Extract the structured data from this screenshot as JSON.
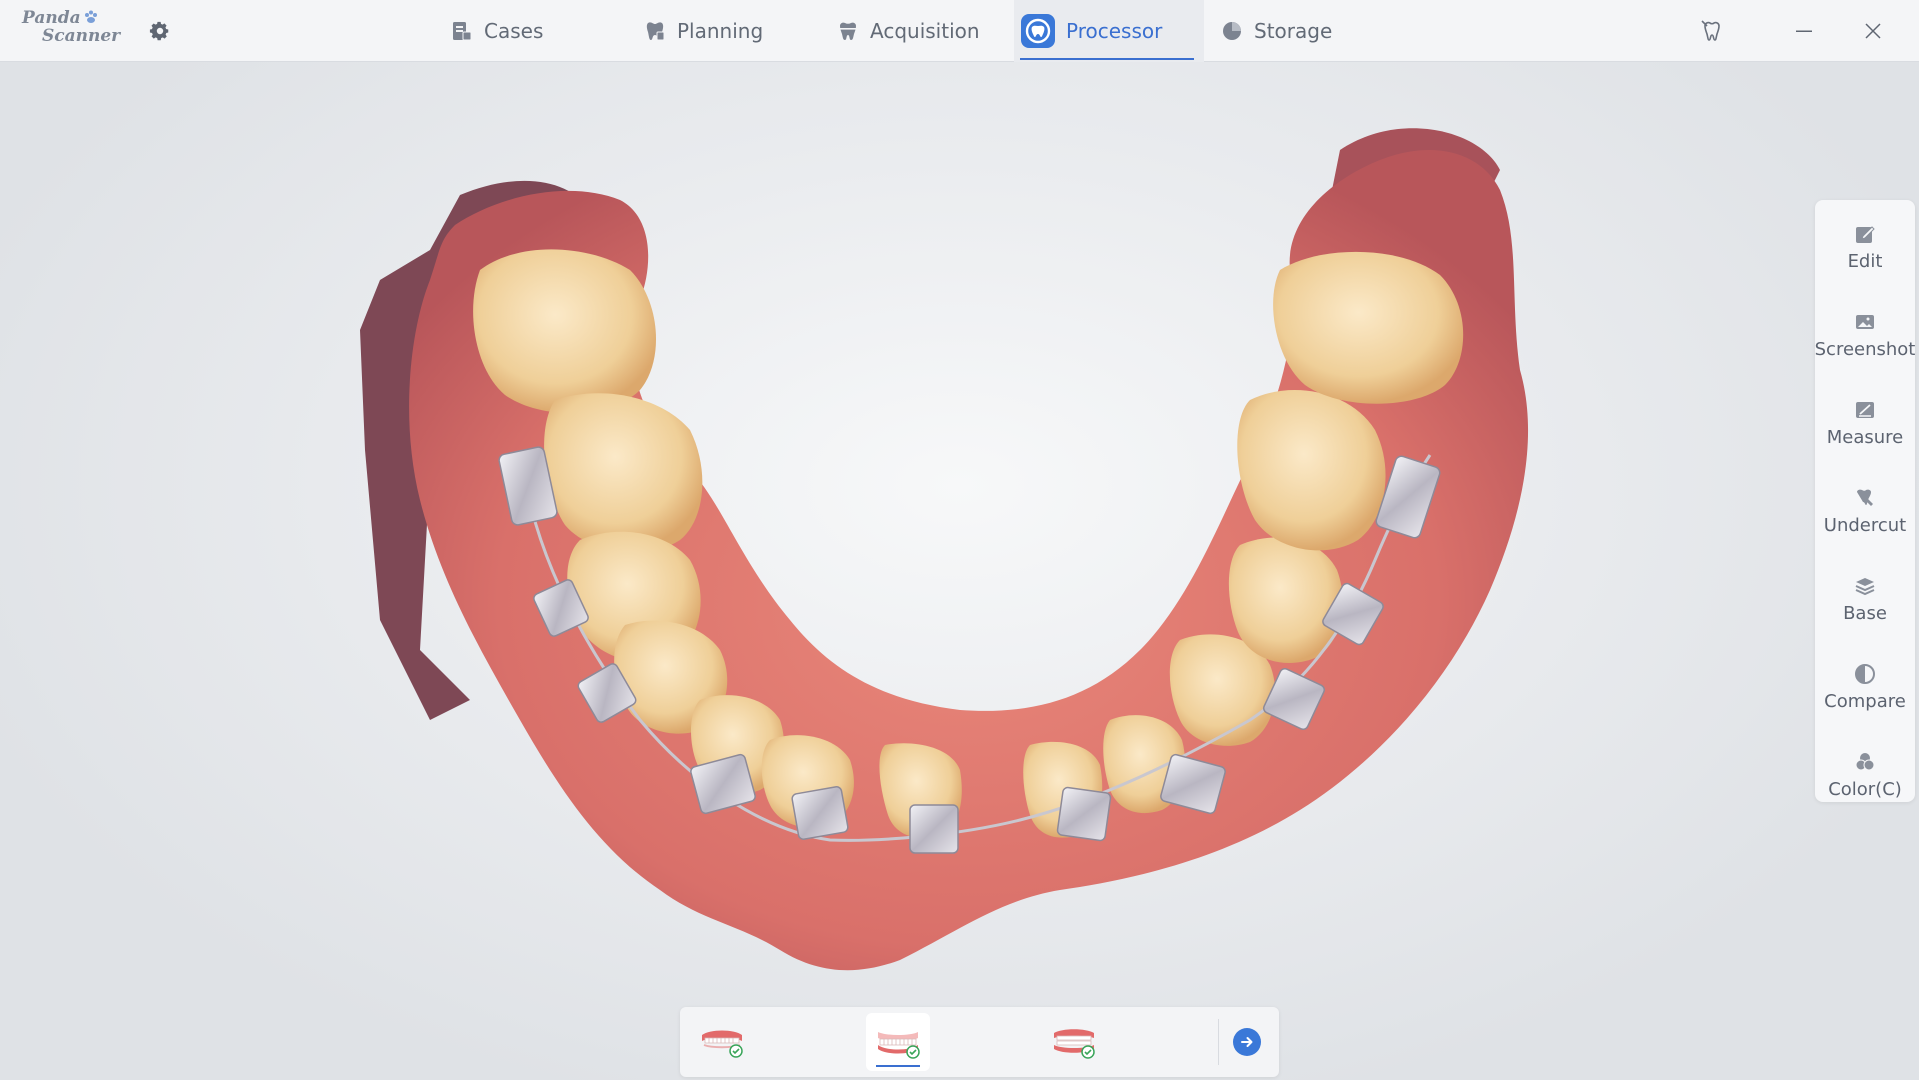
{
  "app": {
    "logo_line1": "Panda",
    "logo_line2": "Scanner",
    "settings_icon": "gear-icon"
  },
  "nav": {
    "tabs": [
      {
        "label": "Cases",
        "icon": "cases-icon",
        "active": false
      },
      {
        "label": "Planning",
        "icon": "planning-icon",
        "active": false
      },
      {
        "label": "Acquisition",
        "icon": "acquisition-tooth-icon",
        "active": false
      },
      {
        "label": "Processor",
        "icon": "processor-icon",
        "active": true
      },
      {
        "label": "Storage",
        "icon": "storage-pie-icon",
        "active": false
      }
    ]
  },
  "window_controls": {
    "tooth_icon": "tooth-pin-icon",
    "minimize_icon": "minimize-icon",
    "close_icon": "close-icon"
  },
  "toolbar": {
    "items": [
      {
        "label": "Edit",
        "icon": "edit-icon"
      },
      {
        "label": "Screenshot",
        "icon": "screenshot-icon"
      },
      {
        "label": "Measure",
        "icon": "measure-icon"
      },
      {
        "label": "Undercut",
        "icon": "undercut-icon"
      },
      {
        "label": "Base",
        "icon": "base-layers-icon"
      },
      {
        "label": "Compare",
        "icon": "compare-icon"
      },
      {
        "label": "Color(C)",
        "icon": "color-icon"
      }
    ]
  },
  "bottom_bar": {
    "jaws": [
      {
        "icon": "upper-jaw-icon",
        "status": "complete",
        "active": false
      },
      {
        "icon": "lower-jaw-icon",
        "status": "complete",
        "active": true
      },
      {
        "icon": "bite-icon",
        "status": "complete",
        "active": false
      }
    ],
    "next_icon": "arrow-right-icon"
  },
  "colors": {
    "accent": "#3a6fd0",
    "check_green": "#3aa55a",
    "gingiva": "#d9776a",
    "tooth": "#f1d7a9",
    "bracket": "#d9d9e0"
  }
}
